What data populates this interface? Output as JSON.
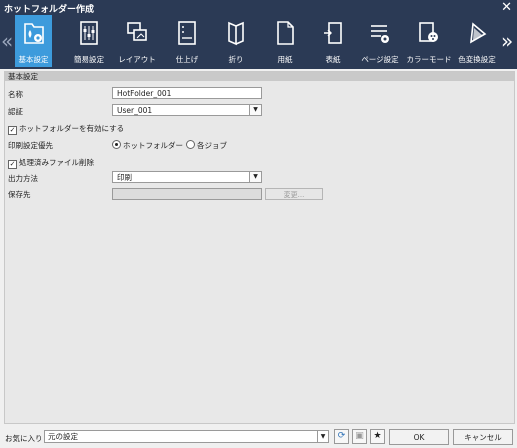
{
  "window": {
    "title": "ホットフォルダー作成",
    "close": "✕"
  },
  "toolbar": {
    "prev": "«",
    "next": "»",
    "items": [
      {
        "label": "基本設定",
        "icon": "folder-gear-icon",
        "active": true
      },
      {
        "label": "簡易設定",
        "icon": "sliders-icon"
      },
      {
        "label": "レイアウト",
        "icon": "layout-icon"
      },
      {
        "label": "仕上げ",
        "icon": "finishing-icon"
      },
      {
        "label": "折り",
        "icon": "fold-icon"
      },
      {
        "label": "用紙",
        "icon": "paper-icon"
      },
      {
        "label": "表紙",
        "icon": "cover-icon"
      },
      {
        "label": "ページ設定",
        "icon": "page-settings-icon"
      },
      {
        "label": "カラーモード",
        "icon": "color-mode-icon"
      },
      {
        "label": "色変換設定",
        "icon": "color-conversion-icon"
      }
    ]
  },
  "section": {
    "title": "基本設定"
  },
  "form": {
    "name_label": "名称",
    "name_value": "HotFolder_001",
    "auth_label": "認証",
    "auth_value": "User_001",
    "enable_label": "ホットフォルダーを有効にする",
    "enable_checked": true,
    "priority_label": "印刷設定優先",
    "priority_options": [
      "ホットフォルダー",
      "各ジョブ"
    ],
    "priority_selected": "ホットフォルダー",
    "delete_label": "処理済みファイル削除",
    "delete_checked": true,
    "output_label": "出力方法",
    "output_value": "印刷",
    "save_label": "保存先",
    "save_value": "",
    "change_button": "変更..."
  },
  "footer": {
    "favorites_label": "お気に入り",
    "favorites_value": "元の設定",
    "ok": "OK",
    "cancel": "キャンセル"
  }
}
